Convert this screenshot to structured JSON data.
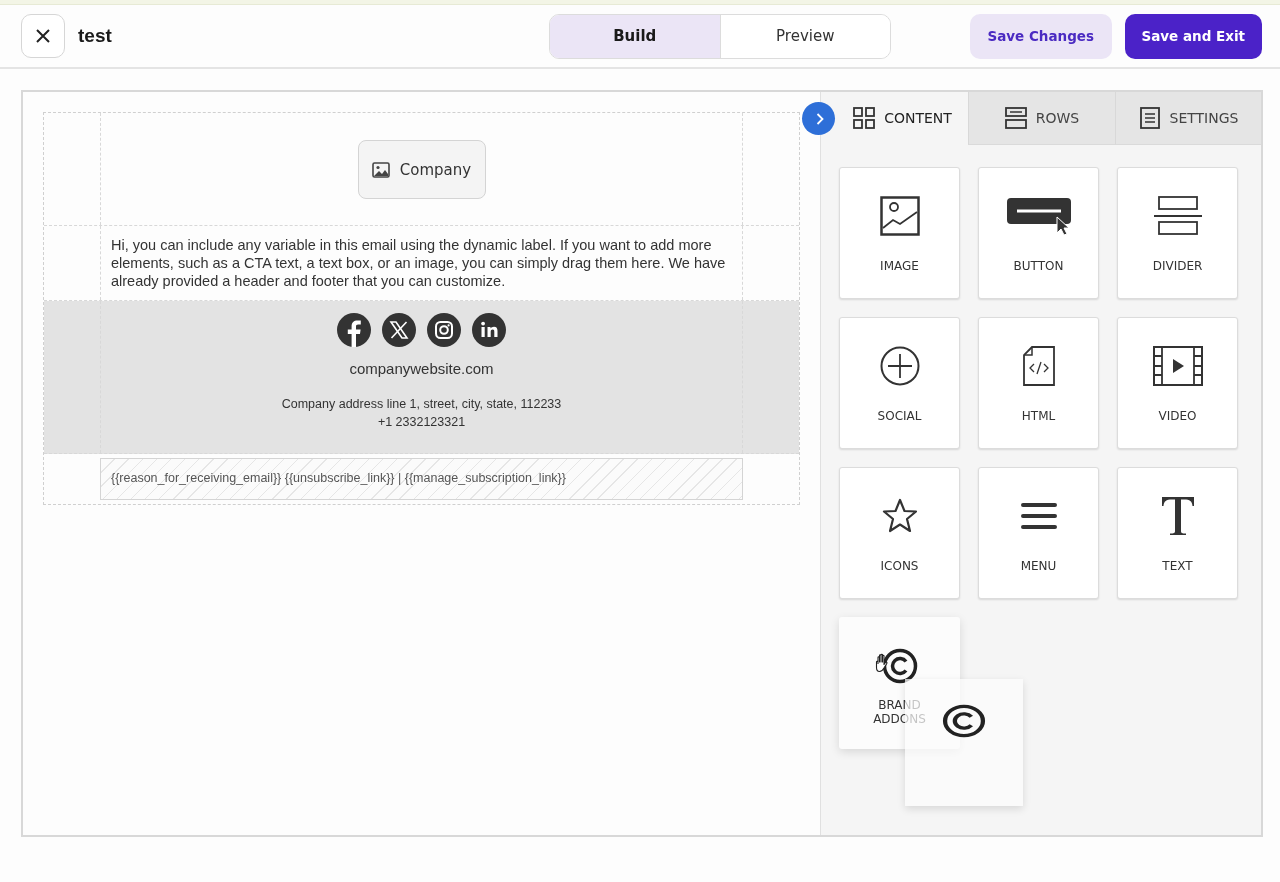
{
  "header": {
    "title": "test",
    "modes": [
      {
        "label": "Build",
        "selected": true
      },
      {
        "label": "Preview",
        "selected": false
      }
    ],
    "actions": [
      {
        "label": "Save Changes",
        "kind": "secondary"
      },
      {
        "label": "Save and Exit",
        "kind": "primary"
      }
    ]
  },
  "email": {
    "logo_label": "Company",
    "body": "Hi, you can include any variable in this email using the dynamic label. If you want to add more elements, such as a CTA text, a text box, or an image, you can simply drag them here. We have already provided a header and footer that you can customize.",
    "website": "companywebsite.com",
    "address": "Company address line 1, street, city, state, 112233",
    "phone": "+1 2332123321",
    "unsubscribe": "{{reason_for_receiving_email}} {{unsubscribe_link}} | {{manage_subscription_link}}"
  },
  "panel": {
    "tabs": [
      {
        "label": "CONTENT",
        "selected": true
      },
      {
        "label": "ROWS",
        "selected": false
      },
      {
        "label": "SETTINGS",
        "selected": false
      }
    ],
    "blocks": [
      {
        "label": "IMAGE",
        "dragging": false
      },
      {
        "label": "BUTTON",
        "dragging": false
      },
      {
        "label": "DIVIDER",
        "dragging": false
      },
      {
        "label": "SOCIAL",
        "dragging": false
      },
      {
        "label": "HTML",
        "dragging": false
      },
      {
        "label": "VIDEO",
        "dragging": false
      },
      {
        "label": "ICONS",
        "dragging": false
      },
      {
        "label": "MENU",
        "dragging": false
      },
      {
        "label": "TEXT",
        "dragging": false
      },
      {
        "label": "BRAND ADDONS",
        "dragging": true
      }
    ]
  }
}
